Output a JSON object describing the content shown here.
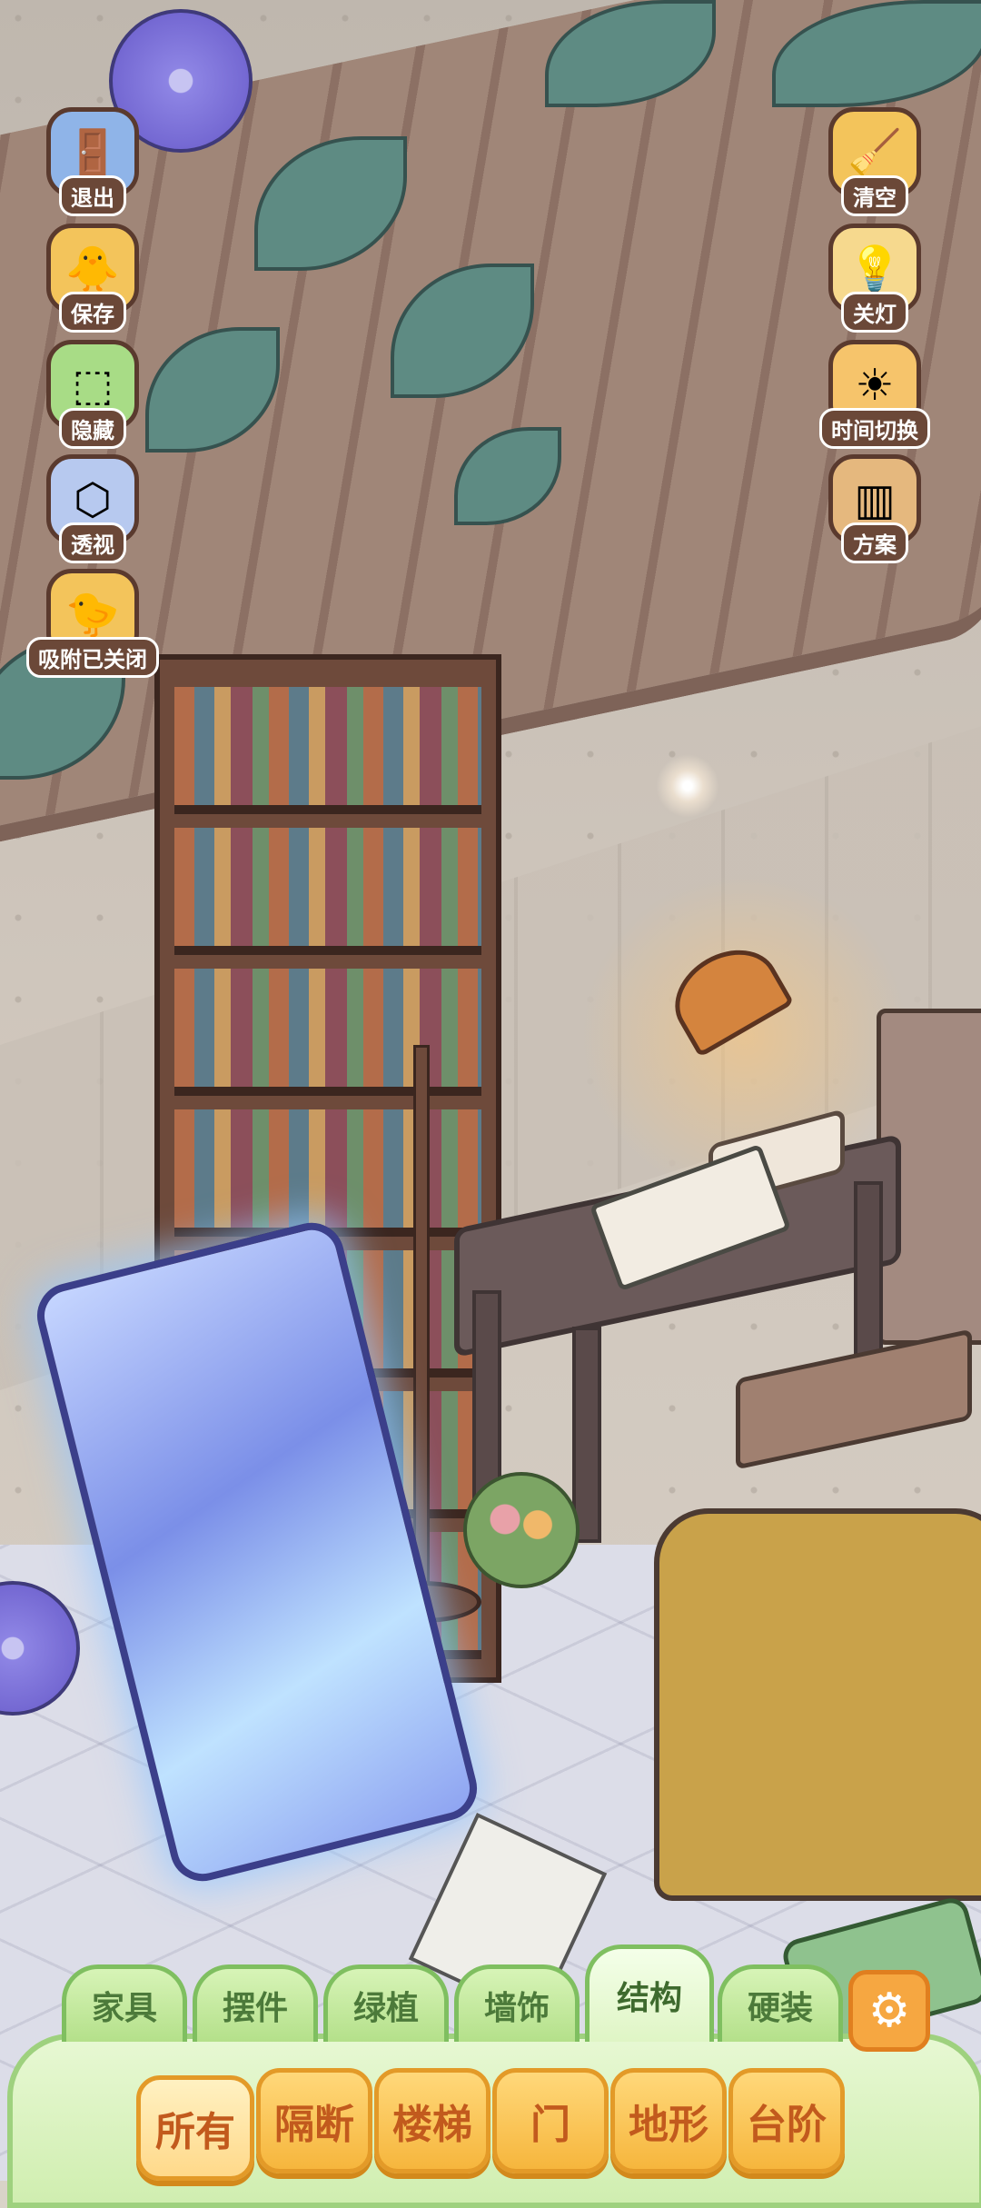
{
  "side_left": [
    {
      "label": "退出",
      "icon": "exit-door-icon"
    },
    {
      "label": "保存",
      "icon": "duck-save-icon"
    },
    {
      "label": "隐藏",
      "icon": "hide-frame-icon"
    },
    {
      "label": "透视",
      "icon": "perspective-cube-icon"
    },
    {
      "label": "吸附已关闭",
      "icon": "snap-off-ducks-icon"
    }
  ],
  "side_right": [
    {
      "label": "清空",
      "icon": "broom-duck-icon"
    },
    {
      "label": "关灯",
      "icon": "lamp-icon"
    },
    {
      "label": "时间切换",
      "icon": "sun-moon-icon"
    },
    {
      "label": "方案",
      "icon": "layout-plan-icon"
    }
  ],
  "tabs": [
    {
      "label": "家具"
    },
    {
      "label": "摆件"
    },
    {
      "label": "绿植"
    },
    {
      "label": "墙饰"
    },
    {
      "label": "结构",
      "active": true
    },
    {
      "label": "硬装"
    }
  ],
  "settings_icon": "gear-icon",
  "chips": [
    {
      "label": "所有",
      "active": true
    },
    {
      "label": "隔断"
    },
    {
      "label": "楼梯"
    },
    {
      "label": "门"
    },
    {
      "label": "地形"
    },
    {
      "label": "台阶"
    }
  ],
  "colors": {
    "tab_green": "#b4e08a",
    "chip_orange": "#f6b63d",
    "chip_text": "#c25a1d",
    "label_brown": "#6b4838"
  }
}
